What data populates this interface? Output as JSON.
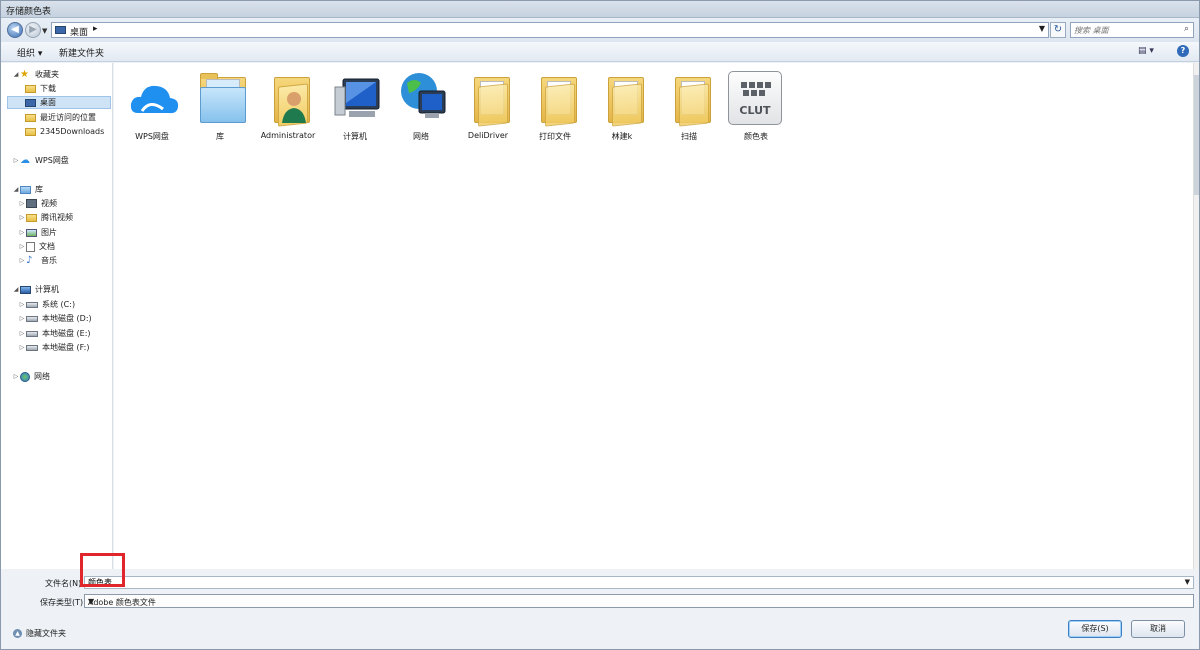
{
  "window": {
    "title": "存储颜色表"
  },
  "address": {
    "crumb": "桌面",
    "search_placeholder": "搜索 桌面"
  },
  "toolbar": {
    "organize": "组织 ▾",
    "new_folder": "新建文件夹"
  },
  "nav": {
    "favorites": "收藏夹",
    "downloads": "下载",
    "desktop": "桌面",
    "recent": "最近访问的位置",
    "downloads2345": "2345Downloads",
    "wps": "WPS网盘",
    "library": "库",
    "video": "视频",
    "tencent_video": "腾讯视频",
    "pictures": "图片",
    "documents": "文档",
    "music": "音乐",
    "computer": "计算机",
    "drive_c": "系统 (C:)",
    "drive_d": "本地磁盘 (D:)",
    "drive_e": "本地磁盘 (E:)",
    "drive_f": "本地磁盘 (F:)",
    "network": "网络"
  },
  "items": {
    "wps": "WPS网盘",
    "library": "库",
    "admin": "Administrator",
    "computer": "计算机",
    "network": "网络",
    "delidriver": "DeliDriver",
    "print_files": "打印文件",
    "linjian": "林建k",
    "scan": "扫描",
    "clut": "颜色表",
    "clut_text": "CLUT"
  },
  "form": {
    "filename_label": "文件名(N):",
    "filename_value": "颜色表",
    "filetype_label": "保存类型(T):",
    "filetype_value": "Adobe 颜色表文件"
  },
  "footer": {
    "hide_folders": "隐藏文件夹",
    "save": "保存(S)",
    "cancel": "取消"
  }
}
